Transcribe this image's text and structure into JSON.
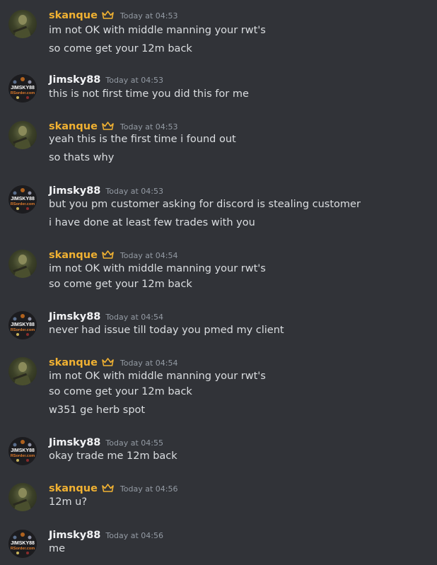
{
  "messages": [
    {
      "author": "skanque",
      "type": "sk",
      "timestamp": "Today at 04:53",
      "lines": [
        "im not OK with middle manning your rwt's",
        "so come get your 12m back"
      ]
    },
    {
      "author": "Jimsky88",
      "type": "jim",
      "timestamp": "Today at 04:53",
      "lines": [
        "this is not first time you did this for me"
      ]
    },
    {
      "author": "skanque",
      "type": "sk",
      "timestamp": "Today at 04:53",
      "lines": [
        "yeah this is the first time i found out",
        "so thats why"
      ]
    },
    {
      "author": "Jimsky88",
      "type": "jim",
      "timestamp": "Today at 04:53",
      "lines": [
        "but you pm customer asking for discord is stealing customer",
        "i have done at least few trades with you"
      ]
    },
    {
      "author": "skanque",
      "type": "sk",
      "timestamp": "Today at 04:54",
      "lines": [
        "im not OK with middle manning your rwt's",
        "so come get your 12m back"
      ]
    },
    {
      "author": "Jimsky88",
      "type": "jim",
      "timestamp": "Today at 04:54",
      "lines": [
        "never had issue till today you pmed my client"
      ]
    },
    {
      "author": "skanque",
      "type": "sk",
      "timestamp": "Today at 04:54",
      "lines": [
        "im not OK with middle manning your rwt's",
        "so come get your 12m back",
        "w351 ge herb spot"
      ]
    },
    {
      "author": "Jimsky88",
      "type": "jim",
      "timestamp": "Today at 04:55",
      "lines": [
        "okay trade me 12m back"
      ]
    },
    {
      "author": "skanque",
      "type": "sk",
      "timestamp": "Today at 04:56",
      "lines": [
        "12m u?"
      ]
    },
    {
      "author": "Jimsky88",
      "type": "jim",
      "timestamp": "Today at 04:56",
      "lines": [
        "me"
      ]
    }
  ],
  "avatar_text": {
    "line1": "JIMSKY88",
    "line2": "RSorder.com"
  },
  "colors": {
    "background": "#313338",
    "owner_name": "#f0b132",
    "member_name": "#f2f3f5",
    "message_text": "#dbdee1",
    "timestamp": "#949ba4",
    "crown": "#f0b132"
  },
  "icons": {
    "owner_badge": "crown-icon"
  }
}
